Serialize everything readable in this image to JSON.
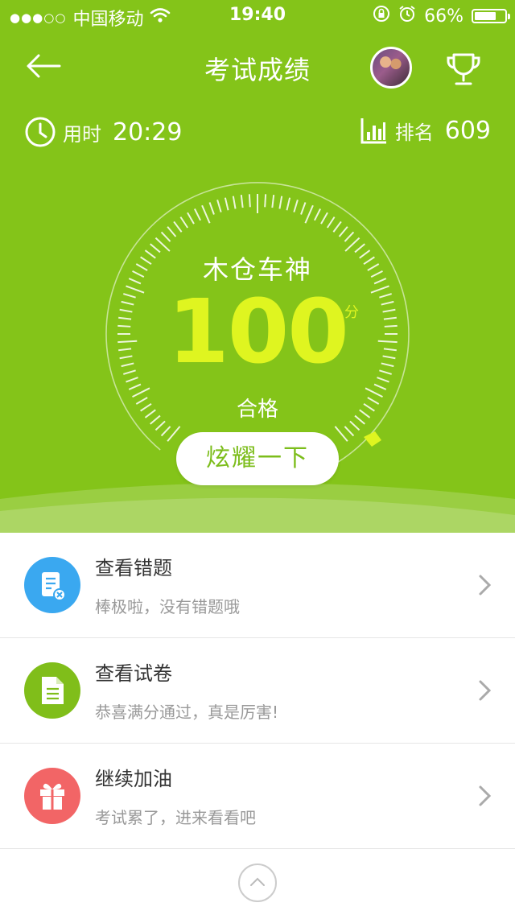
{
  "status_bar": {
    "signal": "●●●○○",
    "carrier": "中国移动",
    "wifi_icon": "wifi-icon",
    "time": "19:40",
    "battery_percent": "66%",
    "battery_level": 0.66
  },
  "nav": {
    "title": "考试成绩",
    "back_icon": "back-arrow-icon",
    "trophy_icon": "trophy-icon"
  },
  "stats": {
    "time_label": "用时",
    "time_value": "20:29",
    "rank_label": "排名",
    "rank_value": "609"
  },
  "result": {
    "level_name": "木仓车神",
    "score": "100",
    "score_unit": "分",
    "status": "合格",
    "share_label": "炫耀一下"
  },
  "actions": [
    {
      "title": "查看错题",
      "subtitle": "棒极啦，没有错题哦",
      "icon": "wrong-questions-icon",
      "color": "#3aa8f0"
    },
    {
      "title": "查看试卷",
      "subtitle": "恭喜满分通过，真是厉害!",
      "icon": "exam-paper-icon",
      "color": "#80be1a"
    },
    {
      "title": "继续加油",
      "subtitle": "考试累了，进来看看吧",
      "icon": "gift-icon",
      "color": "#f26566"
    }
  ],
  "colors": {
    "header_bg": "#84c419",
    "score_color": "#dff520",
    "button_text": "#7cbd1b"
  }
}
